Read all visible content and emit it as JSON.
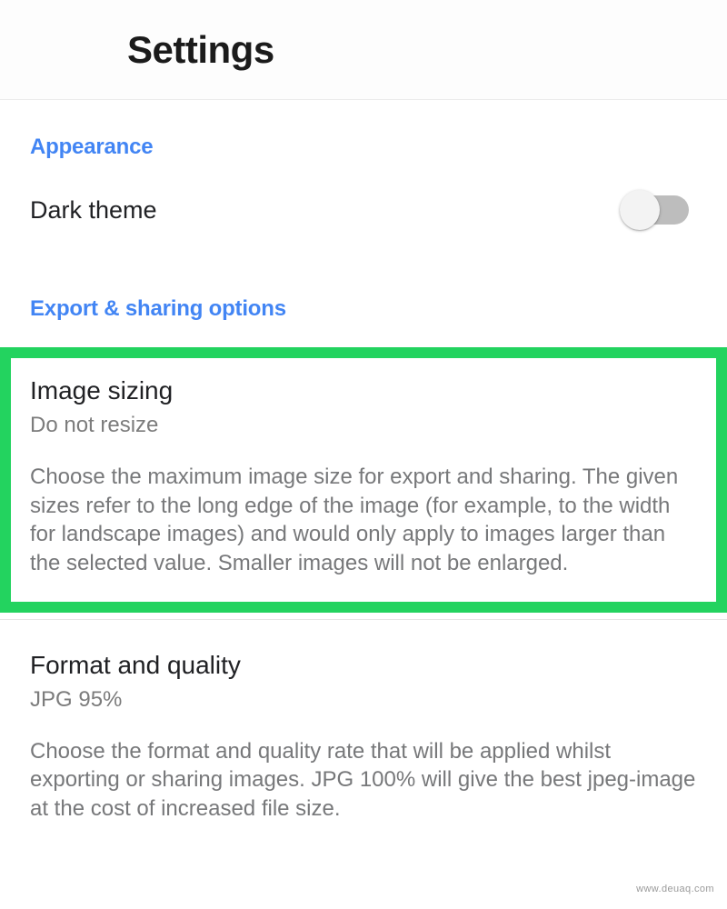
{
  "appbar": {
    "title": "Settings"
  },
  "colors": {
    "accent_blue": "#4285f4",
    "highlight_green": "#23d35f",
    "title_text": "#202124",
    "secondary_text": "#77787a",
    "switch_track_off": "#bdbdbd",
    "switch_thumb": "#f3f3f3"
  },
  "sections": {
    "appearance": {
      "header": "Appearance",
      "dark_theme": {
        "label": "Dark theme",
        "state": "off"
      }
    },
    "export_sharing": {
      "header": "Export & sharing options",
      "image_sizing": {
        "title": "Image sizing",
        "value": "Do not resize",
        "description": "Choose the maximum image size for export and sharing. The given sizes refer to the long edge of the image (for example, to the width for landscape images) and would only apply to images larger than the selected value. Smaller images will not be enlarged.",
        "highlighted": true
      },
      "format_quality": {
        "title": "Format and quality",
        "value": "JPG 95%",
        "description": "Choose the format and quality rate that will be applied whilst exporting or sharing images. JPG 100% will give the best jpeg-image at the cost of increased file size."
      }
    }
  },
  "watermark": "www.deuaq.com"
}
